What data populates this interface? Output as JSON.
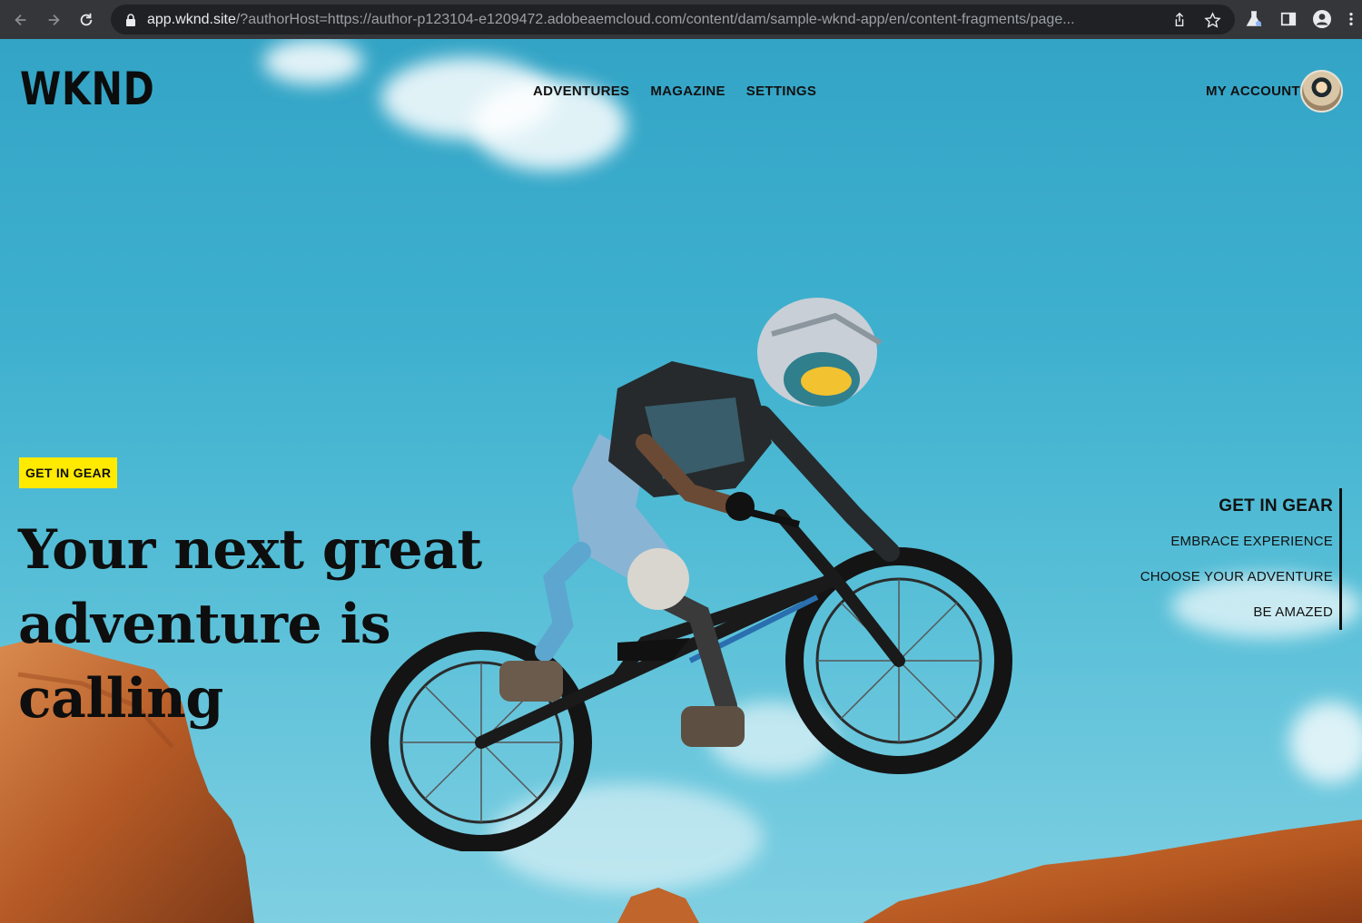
{
  "browser": {
    "url_host": "app.wknd.site",
    "url_rest": "/?authorHost=https://author-p123104-e1209472.adobeaemcloud.com/content/dam/sample-wknd-app/en/content-fragments/page..."
  },
  "header": {
    "logo": "WKND",
    "nav": [
      "ADVENTURES",
      "MAGAZINE",
      "SETTINGS"
    ],
    "account": "MY ACCOUNT"
  },
  "hero": {
    "badge": "GET IN GEAR",
    "headline_line1": "Your next great",
    "headline_line2": "adventure is calling"
  },
  "side_nav": {
    "items": [
      "GET IN GEAR",
      "EMBRACE EXPERIENCE",
      "CHOOSE YOUR ADVENTURE",
      "BE AMAZED"
    ],
    "active": "GET IN GEAR"
  },
  "colors": {
    "badge": "#ffea00",
    "sky": "#3fb1cf",
    "rock": "#c8642c"
  },
  "icons": [
    "back-icon",
    "forward-icon",
    "reload-icon",
    "lock-icon",
    "share-icon",
    "star-icon",
    "labs-icon",
    "side-panel-icon",
    "profile-icon",
    "menu-icon"
  ]
}
